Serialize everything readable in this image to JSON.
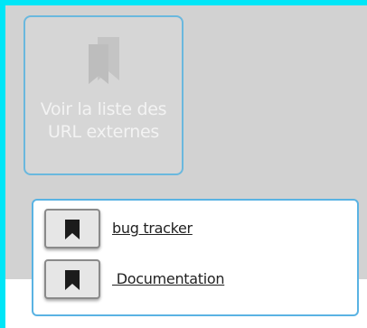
{
  "big_button": {
    "label": "Voir la liste des URL externes",
    "icon": "bookmarks-icon"
  },
  "links": [
    {
      "label": "bug tracker",
      "icon": "bookmark-icon"
    },
    {
      "label": " Documentation",
      "icon": "bookmark-icon"
    }
  ],
  "colors": {
    "background": "#00e6f7",
    "panel": "#d2d2d2",
    "accent_border": "#5ab3e3"
  }
}
